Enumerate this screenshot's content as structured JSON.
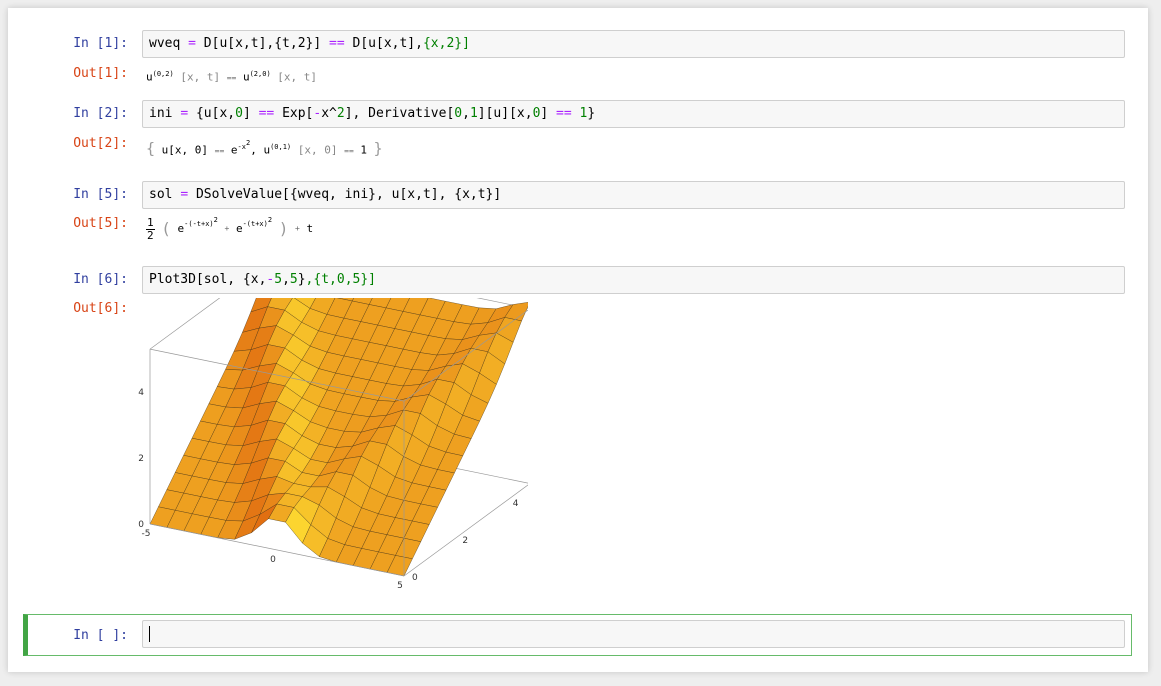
{
  "cells": {
    "c1": {
      "in_prompt": "In [1]:",
      "out_prompt": "Out[1]:",
      "code": [
        "wveq",
        " ",
        "=",
        " D[u[x,t],{t,2}] ",
        "==",
        " D[u[x,t],",
        "{x,",
        "2",
        "}]"
      ],
      "output": {
        "lhs": "u",
        "lhs_sup": "(0,2)",
        "lhs_args": "[x, t]",
        "eq": "==",
        "rhs": "u",
        "rhs_sup": "(2,0)",
        "rhs_args": "[x, t]"
      }
    },
    "c2": {
      "in_prompt": "In [2]:",
      "out_prompt": "Out[2]:",
      "code": [
        "ini",
        " ",
        "=",
        " {u[x,",
        "0",
        "] ",
        "==",
        " Exp[",
        "-",
        "x^",
        "2",
        "], Derivative[",
        "0",
        ",",
        "1",
        "][u][x,",
        "0",
        "] ",
        "==",
        " ",
        "1",
        "}"
      ],
      "output": {
        "open": "{",
        "t1": "u[x, 0]",
        "eq1": "==",
        "e": "e",
        "e_sup": "-x",
        "e_sup2": "2",
        "comma": ",",
        "t2": "u",
        "t2_sup": "(0,1)",
        "t2_args": "[x, 0]",
        "eq2": "==",
        "one": "1",
        "close": "}"
      }
    },
    "c5": {
      "in_prompt": "In [5]:",
      "out_prompt": "Out[5]:",
      "code": [
        "sol",
        " ",
        "=",
        " DSolveValue[{wveq, ini}, u[x,t], {x,t}]"
      ],
      "output": {
        "num": "1",
        "den": "2",
        "lp": "(",
        "e1": "e",
        "e1_sup": "-(-t+x)",
        "e1_sq": "2",
        "plus": "+",
        "e2": "e",
        "e2_sup": "-(t+x)",
        "e2_sq": "2",
        "rp": ")",
        "plus2": "+",
        "t": "t"
      }
    },
    "c6": {
      "in_prompt": "In [6]:",
      "out_prompt": "Out[6]:",
      "code": [
        "Plot3D[sol, {x,",
        "-",
        "5",
        ",",
        "5",
        "}",
        ",{t,",
        "0",
        ",",
        "5",
        "}]"
      ]
    },
    "active": {
      "in_prompt": "In [ ]:"
    }
  },
  "chart_data": {
    "type": "surface3d",
    "function": "1/2 (e^(-(-t+x)^2) + e^(-(t+x)^2)) + t",
    "x_range": [
      -5,
      5
    ],
    "t_range": [
      0,
      5
    ],
    "z_ticks": [
      "0",
      "2",
      "4"
    ],
    "x_ticks": [
      "-5",
      "0",
      "5"
    ],
    "t_ticks": [
      "0",
      "2",
      "4"
    ],
    "mesh": 15,
    "colors": {
      "low": "#ffe233",
      "high": "#e06a10",
      "mesh": "#3a2a10"
    }
  }
}
